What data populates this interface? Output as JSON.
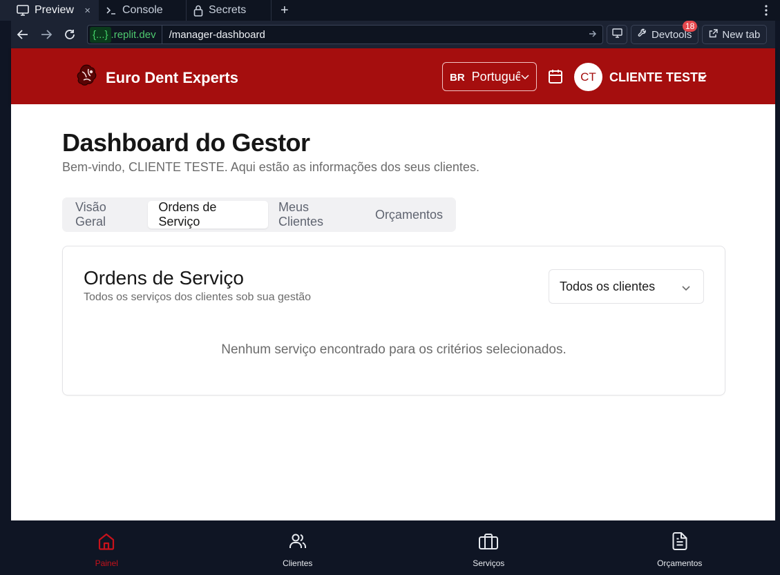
{
  "browser": {
    "tabs": [
      {
        "label": "Preview",
        "icon": "monitor-icon",
        "active": true,
        "close": "×"
      },
      {
        "label": "Console",
        "icon": "terminal-icon"
      },
      {
        "label": "Secrets",
        "icon": "lock-icon"
      }
    ],
    "new_tab": "+",
    "url_badge": "{...}",
    "url_domain": ".replit.dev",
    "url_path": "/manager-dashboard",
    "devtools_label": "Devtools",
    "devtools_count": "18",
    "new_tab_label": "New tab"
  },
  "header": {
    "brand": "Euro Dent Experts",
    "language_code": "BR",
    "language_name": "Português",
    "avatar_initials": "CT",
    "user_name": "CLIENTE TESTE",
    "color": "#a50e0e"
  },
  "page": {
    "title": "Dashboard do Gestor",
    "subtitle": "Bem-vindo, CLIENTE TESTE. Aqui estão as informações dos seus clientes.",
    "tabs": [
      "Visão Geral",
      "Ordens de Serviço",
      "Meus Clientes",
      "Orçamentos"
    ],
    "selected_tab": "Ordens de Serviço"
  },
  "card": {
    "title": "Ordens de Serviço",
    "subtitle": "Todos os serviços dos clientes sob sua gestão",
    "filter_value": "Todos os clientes",
    "empty_message": "Nenhum serviço encontrado para os critérios selecionados."
  },
  "bottom_nav": [
    {
      "label": "Painel",
      "icon": "home-icon",
      "active": true
    },
    {
      "label": "Clientes",
      "icon": "users-icon"
    },
    {
      "label": "Serviços",
      "icon": "briefcase-icon"
    },
    {
      "label": "Orçamentos",
      "icon": "document-icon"
    }
  ],
  "colors": {
    "accent": "#a50e0e",
    "active_nav": "#c8121b",
    "chrome": "#1c2333"
  }
}
